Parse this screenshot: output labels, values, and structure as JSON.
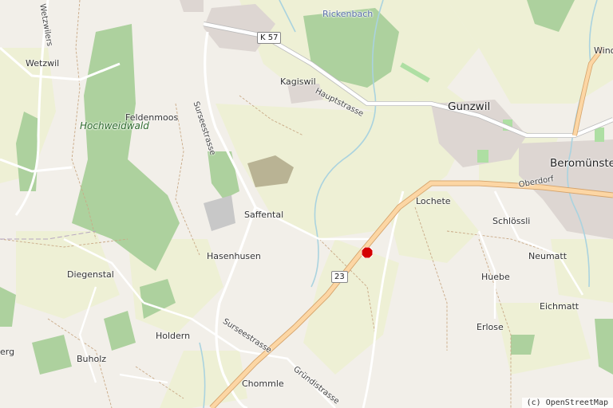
{
  "map": {
    "places": {
      "wetzwil": "Wetzwil",
      "feldenmoos": "Feldenmoos",
      "kagiswil": "Kagiswil",
      "gunzwil": "Gunzwil",
      "beromuenster": "Beromünster",
      "winon": "Winon",
      "lochete": "Lochete",
      "schloessli": "Schlössli",
      "saffental": "Saffental",
      "hasenhusen": "Hasenhusen",
      "neumatt": "Neumatt",
      "huebe": "Huebe",
      "eichmatt": "Eichmatt",
      "diegenstal": "Diegenstal",
      "holdern": "Holdern",
      "erlose": "Erlose",
      "buholz": "Buholz",
      "chommle": "Chommle",
      "berg": "erg"
    },
    "forest_label": "Hochweidwald",
    "stream_label": "Rickenbach",
    "roads": {
      "hauptstrasse": "Hauptstrasse",
      "surseestrasse_north": "Surseestrasse",
      "surseestrasse_south": "Surseestrasse",
      "gruendistrasse": "Gründistrasse",
      "oberdorf": "Oberdorf",
      "wetzwilerstrasse": "Wetzwilers"
    },
    "shields": {
      "k57": "K 57",
      "r23": "23"
    },
    "marker_color": "#d40000"
  },
  "attribution": "(c) OpenStreetMap"
}
